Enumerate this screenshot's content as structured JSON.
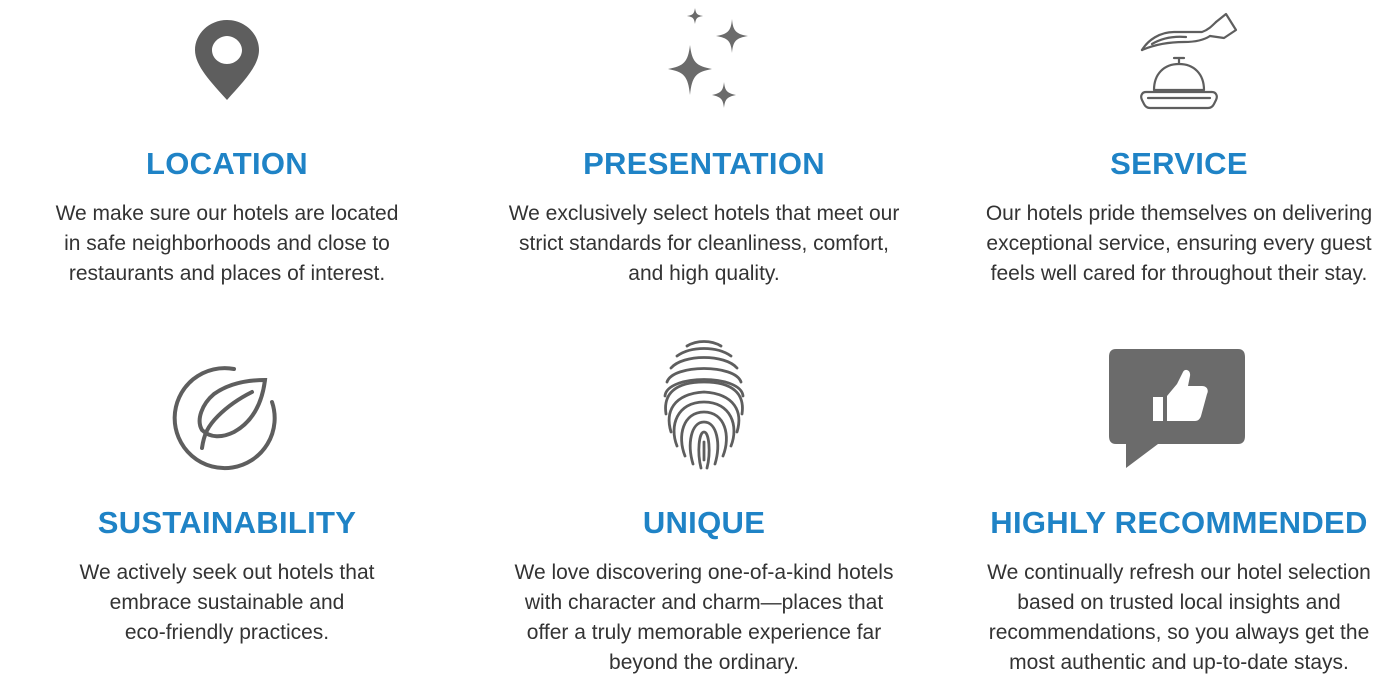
{
  "colors": {
    "accent": "#1f83c6",
    "icon": "#5e5e5e",
    "text": "#333333"
  },
  "features": [
    {
      "icon": "location-pin-icon",
      "title": "LOCATION",
      "lines": [
        "We make sure our hotels are located",
        "in safe neighborhoods and close to",
        "restaurants and places of interest."
      ]
    },
    {
      "icon": "sparkles-icon",
      "title": "PRESENTATION",
      "lines": [
        "We exclusively select hotels that meet our",
        "strict standards for cleanliness, comfort,",
        "and high quality."
      ]
    },
    {
      "icon": "service-bell-icon",
      "title": "SERVICE",
      "lines": [
        "Our hotels pride themselves on delivering",
        "exceptional service, ensuring every guest",
        "feels well cared for throughout their stay."
      ]
    },
    {
      "icon": "leaf-icon",
      "title": "SUSTAINABILITY",
      "lines": [
        "We actively seek out hotels that",
        "embrace sustainable and",
        "eco-friendly practices."
      ]
    },
    {
      "icon": "fingerprint-icon",
      "title": "UNIQUE",
      "lines": [
        "We love discovering one-of-a-kind hotels",
        "with character and charm—places that",
        "offer a truly memorable experience far",
        "beyond the ordinary."
      ]
    },
    {
      "icon": "thumbs-up-icon",
      "title": "HIGHLY RECOMMENDED",
      "lines": [
        "We continually refresh our hotel selection",
        "based on trusted local insights and",
        "recommendations, so you always get the",
        "most authentic and up-to-date stays."
      ]
    }
  ]
}
